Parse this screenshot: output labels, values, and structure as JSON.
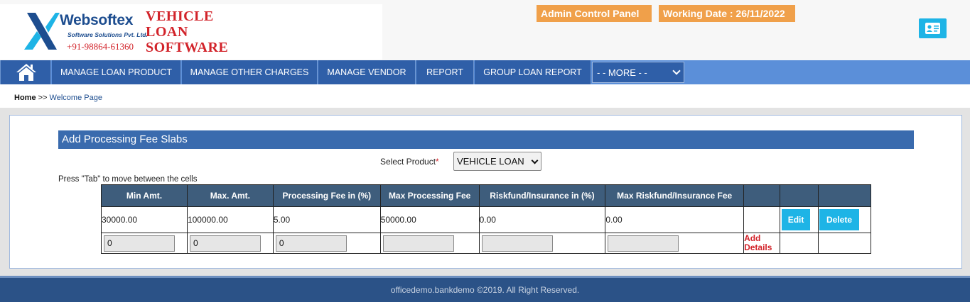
{
  "header": {
    "brand": "Websoftex",
    "brand_sub": "Software Solutions Pvt. Ltd.",
    "phone": "+91-98864-61360",
    "app_title_lines": [
      "VEHICLE",
      "LOAN",
      "SOFTWARE"
    ],
    "admin_badge": "Admin Control Panel",
    "working_date": "Working Date : 26/11/2022",
    "colors": {
      "brand": "#1d4d8f",
      "title": "#d2232a",
      "badge": "#f0a04a",
      "accent": "#1eb4e6"
    }
  },
  "nav": {
    "home_icon": "home-icon",
    "items": [
      "MANAGE LOAN PRODUCT",
      "MANAGE OTHER CHARGES",
      "MANAGE VENDOR",
      "REPORT",
      "GROUP LOAN REPORT"
    ],
    "more": "- - MORE - -"
  },
  "breadcrumb": {
    "home": "Home",
    "sep": ">>",
    "current": "Welcome Page"
  },
  "section": {
    "title": "Add Processing Fee Slabs",
    "select_label": "Select Product",
    "required_mark": "*",
    "selected_product": "VEHICLE LOAN",
    "hint": "Press \"Tab\" to move between the cells"
  },
  "table": {
    "headers": [
      "Min Amt.",
      "Max. Amt.",
      "Processing Fee in (%)",
      "Max Processing Fee",
      "Riskfund/Insurance in (%)",
      "Max Riskfund/Insurance Fee",
      "",
      "",
      ""
    ],
    "row": [
      "30000.00",
      "100000.00",
      "5.00",
      "50000.00",
      "0.00",
      "0.00"
    ],
    "edit_label": "Edit",
    "delete_label": "Delete",
    "inputs": [
      "0",
      "0",
      "0",
      "",
      "",
      ""
    ],
    "add_label_1": "Add",
    "add_label_2": "Details"
  },
  "footer": {
    "text": "officedemo.bankdemo ©2019. All Right Reserved."
  }
}
